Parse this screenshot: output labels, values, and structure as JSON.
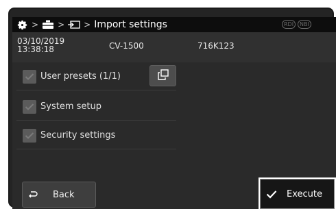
{
  "header": {
    "breadcrumb_sep": ">",
    "page_title": "Import settings",
    "tags": [
      "RDI",
      "NBI"
    ]
  },
  "info": {
    "date": "03/10/2019",
    "time": "13:38:18",
    "model": "CV-1500",
    "serial": "716K123"
  },
  "items": [
    {
      "label": "User presets (1/1)",
      "checked": true
    },
    {
      "label": "System setup",
      "checked": true
    },
    {
      "label": "Security settings",
      "checked": true
    }
  ],
  "footer": {
    "back_label": "Back",
    "execute_label": "Execute"
  },
  "colors": {
    "background": "#2a2a2a",
    "titlebar": "#0d0d0d",
    "checkbox": "#5b5b5b",
    "accent": "#ffffff"
  }
}
